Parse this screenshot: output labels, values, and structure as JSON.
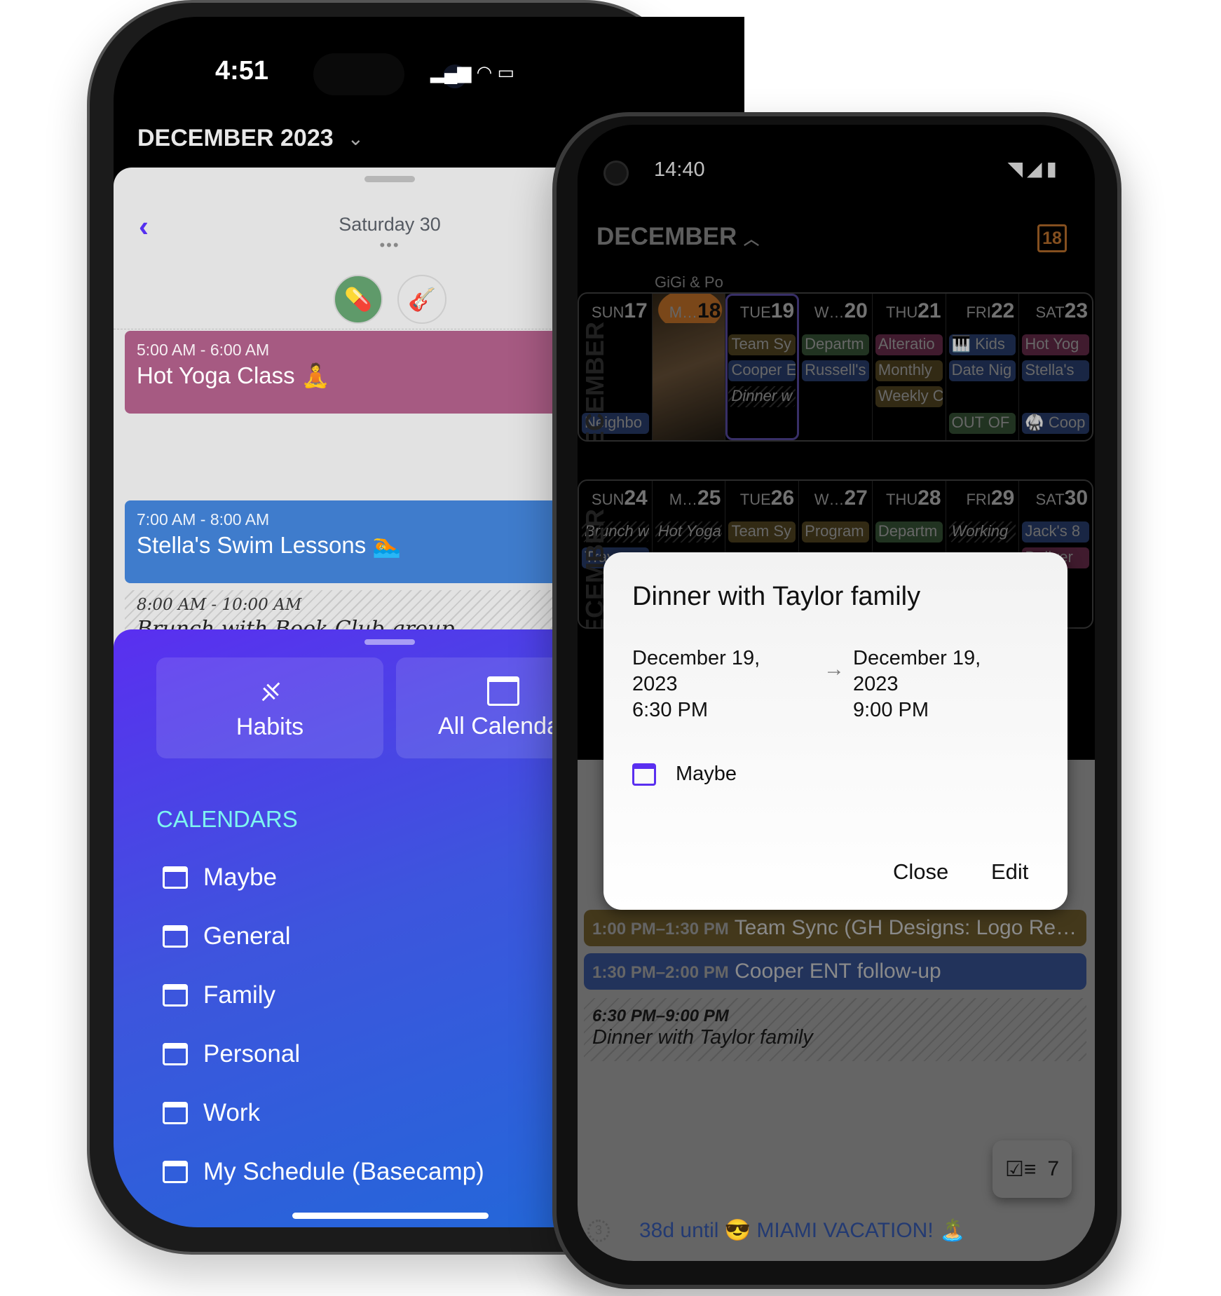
{
  "ios": {
    "status_time": "4:51",
    "month_title": "DECEMBER 2023",
    "day_title": "Saturday 30",
    "more": "•••",
    "habit_icons": [
      "pill-icon",
      "guitar-icon"
    ],
    "events": [
      {
        "time": "5:00 AM - 6:00 AM",
        "title": "Hot Yoga Class 🧘",
        "color": "#a65a82"
      },
      {
        "time": "7:00 AM - 8:00 AM",
        "title": "Stella's Swim Lessons 🏊",
        "color": "#3f7ccc"
      },
      {
        "time": "8:00 AM - 10:00 AM",
        "title": "Brunch with Book Club group",
        "style": "tentative"
      }
    ],
    "cards": [
      {
        "label": "Habits",
        "icon": "dumbbell-icon"
      },
      {
        "label": "All Calendars",
        "icon": "calendar-icon"
      }
    ],
    "calendars_header": "CALENDARS",
    "calendars": [
      "Maybe",
      "General",
      "Family",
      "Personal",
      "Work",
      "My Schedule (Basecamp)"
    ]
  },
  "android": {
    "status_time": "14:40",
    "month_title": "DECEMBER",
    "today_badge": "18",
    "banner": "GiGi & Po",
    "month_vertical": "DECEMBER",
    "weeks": [
      {
        "days": [
          {
            "dow": "SUN",
            "num": "17",
            "chips": [],
            "bottom": [
              {
                "t": "Neighbo",
                "c": "blue"
              }
            ]
          },
          {
            "dow": "M…",
            "num": "18",
            "today": true,
            "photo": true,
            "chips": [],
            "bottom": []
          },
          {
            "dow": "TUE",
            "num": "19",
            "selected": true,
            "chips": [
              {
                "t": "Team Sy",
                "c": "olive"
              },
              {
                "t": "Cooper E",
                "c": "blue"
              },
              {
                "t": "Dinner w",
                "c": "stripe"
              }
            ],
            "bottom": []
          },
          {
            "dow": "W…",
            "num": "20",
            "chips": [
              {
                "t": "Departm",
                "c": "green"
              },
              {
                "t": "Russell's",
                "c": "blue"
              }
            ],
            "bottom": []
          },
          {
            "dow": "THU",
            "num": "21",
            "chips": [
              {
                "t": "Alteratio",
                "c": "pink"
              },
              {
                "t": "Monthly",
                "c": "olive"
              },
              {
                "t": "Weekly C",
                "c": "olive"
              }
            ],
            "bottom": []
          },
          {
            "dow": "FRI",
            "num": "22",
            "chips": [
              {
                "t": "🎹 Kids",
                "c": "blue"
              },
              {
                "t": "Date Nig",
                "c": "blue"
              }
            ],
            "bottom": [
              {
                "t": "OUT OF",
                "c": "green"
              }
            ]
          },
          {
            "dow": "SAT",
            "num": "23",
            "chips": [
              {
                "t": "Hot Yog",
                "c": "pink"
              },
              {
                "t": "Stella's",
                "c": "blue"
              }
            ],
            "bottom": [
              {
                "t": "🥋 Coop",
                "c": "blue"
              }
            ]
          }
        ]
      },
      {
        "days": [
          {
            "dow": "SUN",
            "num": "24",
            "chips": [
              {
                "t": "Brunch w",
                "c": "stripe"
              },
              {
                "t": "Trav",
                "c": "blue"
              }
            ],
            "bottom": []
          },
          {
            "dow": "M…",
            "num": "25",
            "chips": [
              {
                "t": "Hot Yoga",
                "c": "stripe"
              }
            ],
            "bottom": []
          },
          {
            "dow": "TUE",
            "num": "26",
            "chips": [
              {
                "t": "Team Sy",
                "c": "olive"
              }
            ],
            "bottom": []
          },
          {
            "dow": "W…",
            "num": "27",
            "chips": [
              {
                "t": "Program",
                "c": "olive"
              }
            ],
            "bottom": []
          },
          {
            "dow": "THU",
            "num": "28",
            "chips": [
              {
                "t": "Departm",
                "c": "green"
              }
            ],
            "bottom": []
          },
          {
            "dow": "FRI",
            "num": "29",
            "chips": [
              {
                "t": "Working",
                "c": "stripe"
              }
            ],
            "bottom": []
          },
          {
            "dow": "SAT",
            "num": "30",
            "chips": [
              {
                "t": "Jack's 8",
                "c": "blue"
              },
              {
                "t": "Deliver",
                "c": "pink"
              }
            ],
            "bottom": []
          }
        ]
      }
    ],
    "agenda": [
      {
        "time": "1:00 PM–1:30 PM",
        "title": "Team Sync (GH Designs: Logo Re…",
        "color": "olive"
      },
      {
        "time": "1:30 PM–2:00 PM",
        "title": "Cooper ENT follow-up",
        "color": "blue"
      },
      {
        "time": "6:30 PM–9:00 PM",
        "title": "Dinner with Taylor family",
        "style": "tentative"
      }
    ],
    "tasks_count": "7",
    "countdown_badge": "3",
    "countdown": "38d until 😎 MIAMI VACATION! 🏝️",
    "dialog": {
      "title": "Dinner with Taylor family",
      "start_date": "December 19, 2023",
      "start_time": "6:30 PM",
      "end_date": "December 19, 2023",
      "end_time": "9:00 PM",
      "calendar": "Maybe",
      "close": "Close",
      "edit": "Edit"
    }
  },
  "colors": {
    "accent_purple": "#5a2ff0",
    "calendars_header": "#7ef4f0",
    "today_orange": "#b06a2a"
  }
}
